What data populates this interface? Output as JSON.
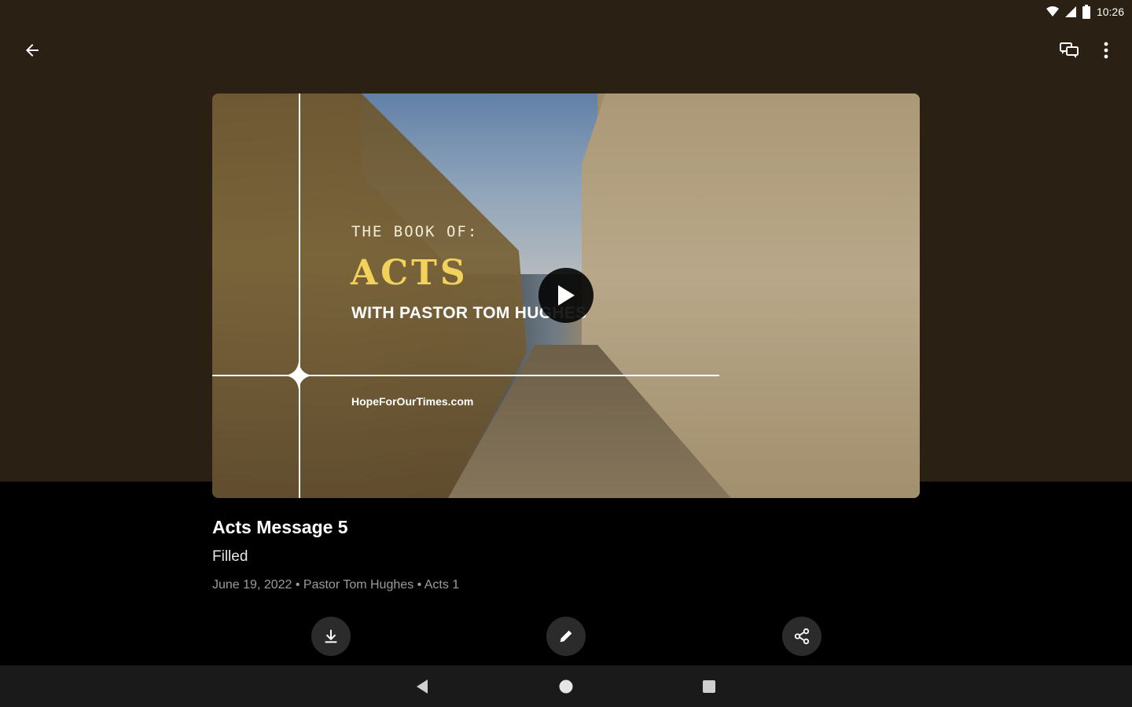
{
  "status_bar": {
    "time": "10:26"
  },
  "video": {
    "overlay_line1": "THE BOOK OF:",
    "overlay_title": "ACTS",
    "overlay_pastor": "WITH PASTOR TOM HUGHES",
    "overlay_url": "HopeForOurTimes.com"
  },
  "message": {
    "title": "Acts Message 5",
    "subtitle": "Filled",
    "meta": "June 19, 2022 • Pastor Tom Hughes • Acts 1"
  },
  "icons": {
    "back": "arrow-back-icon",
    "chat": "chat-icon",
    "more": "more-vert-icon",
    "play": "play-icon",
    "download": "download-icon",
    "edit": "edit-icon",
    "share": "share-icon"
  },
  "colors": {
    "header_bg": "#2a2013",
    "accent_title": "#f3d25b",
    "page_bg": "#000000"
  }
}
